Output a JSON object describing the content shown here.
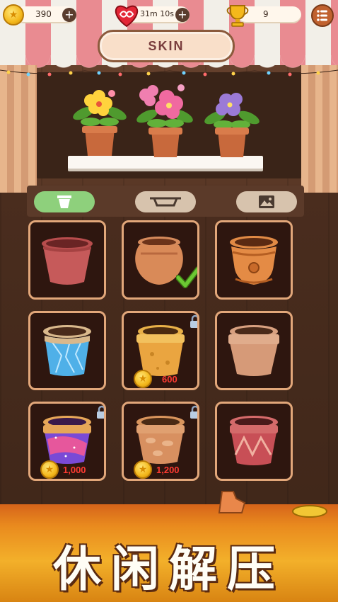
{
  "topbar": {
    "coins": "390",
    "lives_timer": "31m 10s",
    "trophies": "9"
  },
  "title": "SKIN",
  "tabs": [
    {
      "name": "pots",
      "active": true
    },
    {
      "name": "shelves",
      "active": false
    },
    {
      "name": "backgrounds",
      "active": false
    }
  ],
  "skins": [
    {
      "name": "terracotta-pot",
      "state": "owned"
    },
    {
      "name": "round-clay-pot",
      "state": "selected"
    },
    {
      "name": "ornate-orange-pot",
      "state": "owned"
    },
    {
      "name": "crystal-pot",
      "state": "owned"
    },
    {
      "name": "sandstone-pot",
      "state": "locked",
      "price": "600"
    },
    {
      "name": "beige-clay-pot",
      "state": "owned"
    },
    {
      "name": "galaxy-pot",
      "state": "locked",
      "price": "1,000"
    },
    {
      "name": "stone-pot",
      "state": "locked",
      "price": "1,200"
    },
    {
      "name": "diamond-pattern-pot",
      "state": "owned"
    }
  ],
  "slogan": "休闲解压",
  "colors": {
    "accent_tab": "#8ed07c",
    "price_red": "#ff3b32",
    "card_border": "#e2a77a",
    "checkmark": "#6cc833"
  }
}
